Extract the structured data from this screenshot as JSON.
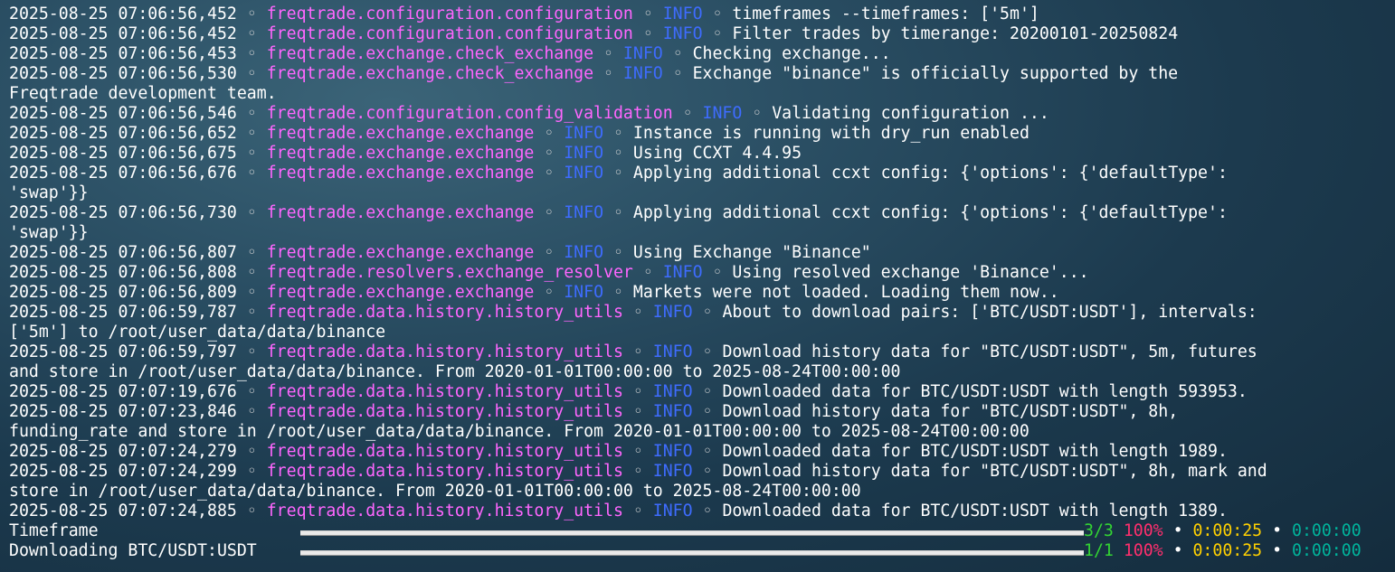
{
  "log_lines": [
    {
      "ts": "2025-08-25 07:06:56,452",
      "logger": "freqtrade.configuration.configuration",
      "level": "INFO",
      "msg": "timeframes --timeframes: ['5m']"
    },
    {
      "ts": "2025-08-25 07:06:56,452",
      "logger": "freqtrade.configuration.configuration",
      "level": "INFO",
      "msg": "Filter trades by timerange: 20200101-20250824"
    },
    {
      "ts": "2025-08-25 07:06:56,453",
      "logger": "freqtrade.exchange.check_exchange",
      "level": "INFO",
      "msg": "Checking exchange..."
    },
    {
      "ts": "2025-08-25 07:06:56,530",
      "logger": "freqtrade.exchange.check_exchange",
      "level": "INFO",
      "msg": "Exchange \"binance\" is officially supported by the",
      "cont": "Freqtrade development team."
    },
    {
      "ts": "2025-08-25 07:06:56,546",
      "logger": "freqtrade.configuration.config_validation",
      "level": "INFO",
      "msg": "Validating configuration ..."
    },
    {
      "ts": "2025-08-25 07:06:56,652",
      "logger": "freqtrade.exchange.exchange",
      "level": "INFO",
      "msg": "Instance is running with dry_run enabled"
    },
    {
      "ts": "2025-08-25 07:06:56,675",
      "logger": "freqtrade.exchange.exchange",
      "level": "INFO",
      "msg": "Using CCXT 4.4.95"
    },
    {
      "ts": "2025-08-25 07:06:56,676",
      "logger": "freqtrade.exchange.exchange",
      "level": "INFO",
      "msg": "Applying additional ccxt config: {'options': {'defaultType':",
      "cont": "'swap'}}"
    },
    {
      "ts": "2025-08-25 07:06:56,730",
      "logger": "freqtrade.exchange.exchange",
      "level": "INFO",
      "msg": "Applying additional ccxt config: {'options': {'defaultType':",
      "cont": "'swap'}}"
    },
    {
      "ts": "2025-08-25 07:06:56,807",
      "logger": "freqtrade.exchange.exchange",
      "level": "INFO",
      "msg": "Using Exchange \"Binance\""
    },
    {
      "ts": "2025-08-25 07:06:56,808",
      "logger": "freqtrade.resolvers.exchange_resolver",
      "level": "INFO",
      "msg": "Using resolved exchange 'Binance'..."
    },
    {
      "ts": "2025-08-25 07:06:56,809",
      "logger": "freqtrade.exchange.exchange",
      "level": "INFO",
      "msg": "Markets were not loaded. Loading them now.."
    },
    {
      "ts": "2025-08-25 07:06:59,787",
      "logger": "freqtrade.data.history.history_utils",
      "level": "INFO",
      "msg": "About to download pairs: ['BTC/USDT:USDT'], intervals:",
      "cont": "['5m'] to /root/user_data/data/binance"
    },
    {
      "ts": "2025-08-25 07:06:59,797",
      "logger": "freqtrade.data.history.history_utils",
      "level": "INFO",
      "msg": "Download history data for \"BTC/USDT:USDT\", 5m, futures",
      "cont": "and store in /root/user_data/data/binance. From 2020-01-01T00:00:00 to 2025-08-24T00:00:00"
    },
    {
      "ts": "2025-08-25 07:07:19,676",
      "logger": "freqtrade.data.history.history_utils",
      "level": "INFO",
      "msg": "Downloaded data for BTC/USDT:USDT with length 593953."
    },
    {
      "ts": "2025-08-25 07:07:23,846",
      "logger": "freqtrade.data.history.history_utils",
      "level": "INFO",
      "msg": "Download history data for \"BTC/USDT:USDT\", 8h,",
      "cont": "funding_rate and store in /root/user_data/data/binance. From 2020-01-01T00:00:00 to 2025-08-24T00:00:00"
    },
    {
      "ts": "2025-08-25 07:07:24,279",
      "logger": "freqtrade.data.history.history_utils",
      "level": "INFO",
      "msg": "Downloaded data for BTC/USDT:USDT with length 1989."
    },
    {
      "ts": "2025-08-25 07:07:24,299",
      "logger": "freqtrade.data.history.history_utils",
      "level": "INFO",
      "msg": "Download history data for \"BTC/USDT:USDT\", 8h, mark and",
      "cont": "store in /root/user_data/data/binance. From 2020-01-01T00:00:00 to 2025-08-24T00:00:00"
    },
    {
      "ts": "2025-08-25 07:07:24,885",
      "logger": "freqtrade.data.history.history_utils",
      "level": "INFO",
      "msg": "Downloaded data for BTC/USDT:USDT with length 1389."
    }
  ],
  "separator": "◦",
  "progress": [
    {
      "label": "Timeframe",
      "count": "3/3",
      "percent": "100%",
      "progress": 1.0,
      "elapsed": "0:00:25",
      "remaining": "0:00:00"
    },
    {
      "label": "Downloading BTC/USDT:USDT",
      "count": "1/1",
      "percent": "100%",
      "progress": 1.0,
      "elapsed": "0:00:25",
      "remaining": "0:00:00"
    }
  ],
  "bullet": "•",
  "colors": {
    "logger": "#ff66ff",
    "level": "#3e6cff",
    "count": "#33d433",
    "percent": "#ff2f6d",
    "elapsed": "#ffd000",
    "remaining": "#00b39b"
  }
}
